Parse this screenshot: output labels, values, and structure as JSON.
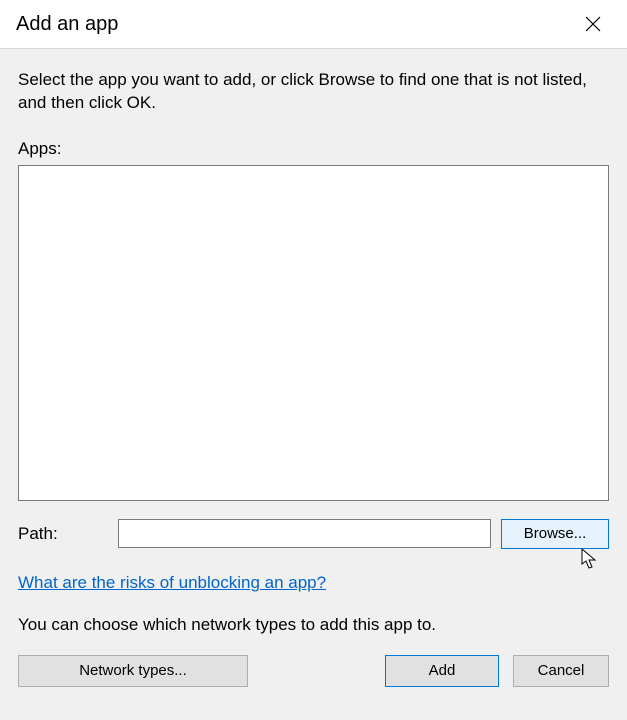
{
  "titlebar": {
    "title": "Add an app"
  },
  "instructions": "Select the app you want to add, or click Browse to find one that is not listed, and then click OK.",
  "apps": {
    "label": "Apps:",
    "items": []
  },
  "path": {
    "label": "Path:",
    "value": "",
    "browse_label": "Browse..."
  },
  "risk_link": "What are the risks of unblocking an app?",
  "network_text": "You can choose which network types to add this app to.",
  "buttons": {
    "network_types": "Network types...",
    "add": "Add",
    "cancel": "Cancel"
  }
}
